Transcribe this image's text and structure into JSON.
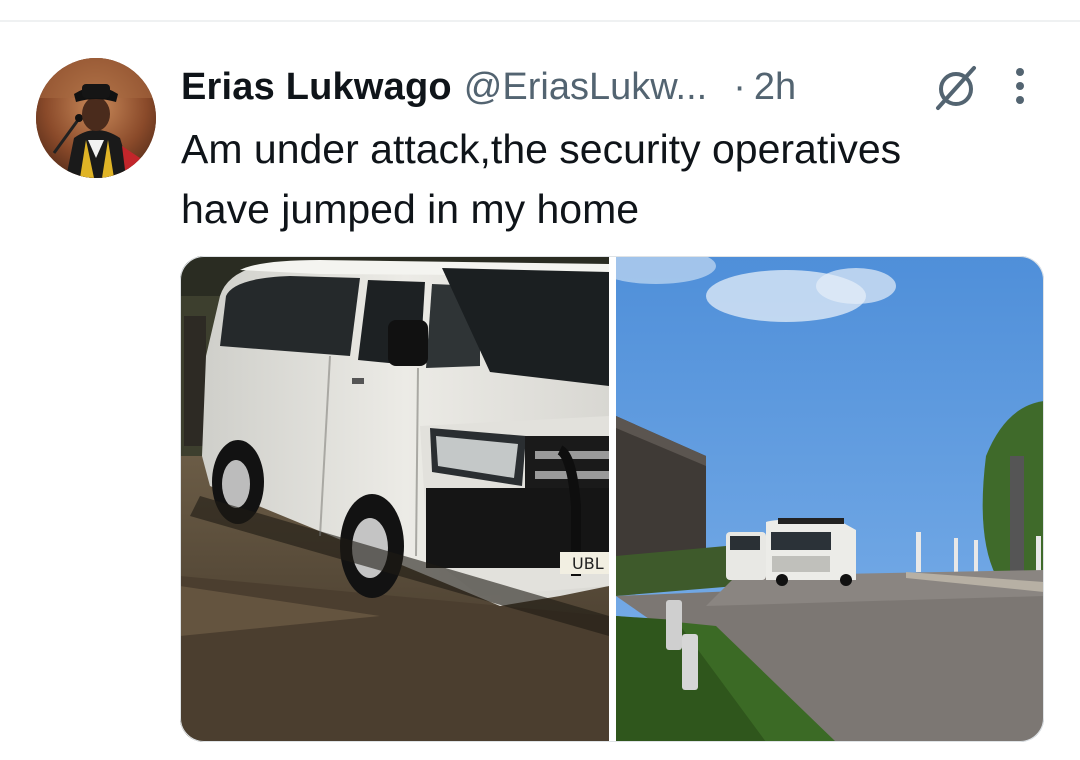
{
  "tweet": {
    "author_name": "Erias Lukwago",
    "author_handle": "@EriasLukw...",
    "separator": "·",
    "timestamp": "2h",
    "text_line_1": "Am under attack,the security operatives",
    "text_line_2": "have jumped in my home"
  },
  "media": {
    "photo_1_plate": "UBL"
  },
  "icons": {
    "grok": "grok-slash-circle-icon",
    "more": "vertical-ellipsis-icon"
  },
  "colors": {
    "text_primary": "#0f1419",
    "text_secondary": "#536471",
    "divider": "#eff1f2"
  }
}
